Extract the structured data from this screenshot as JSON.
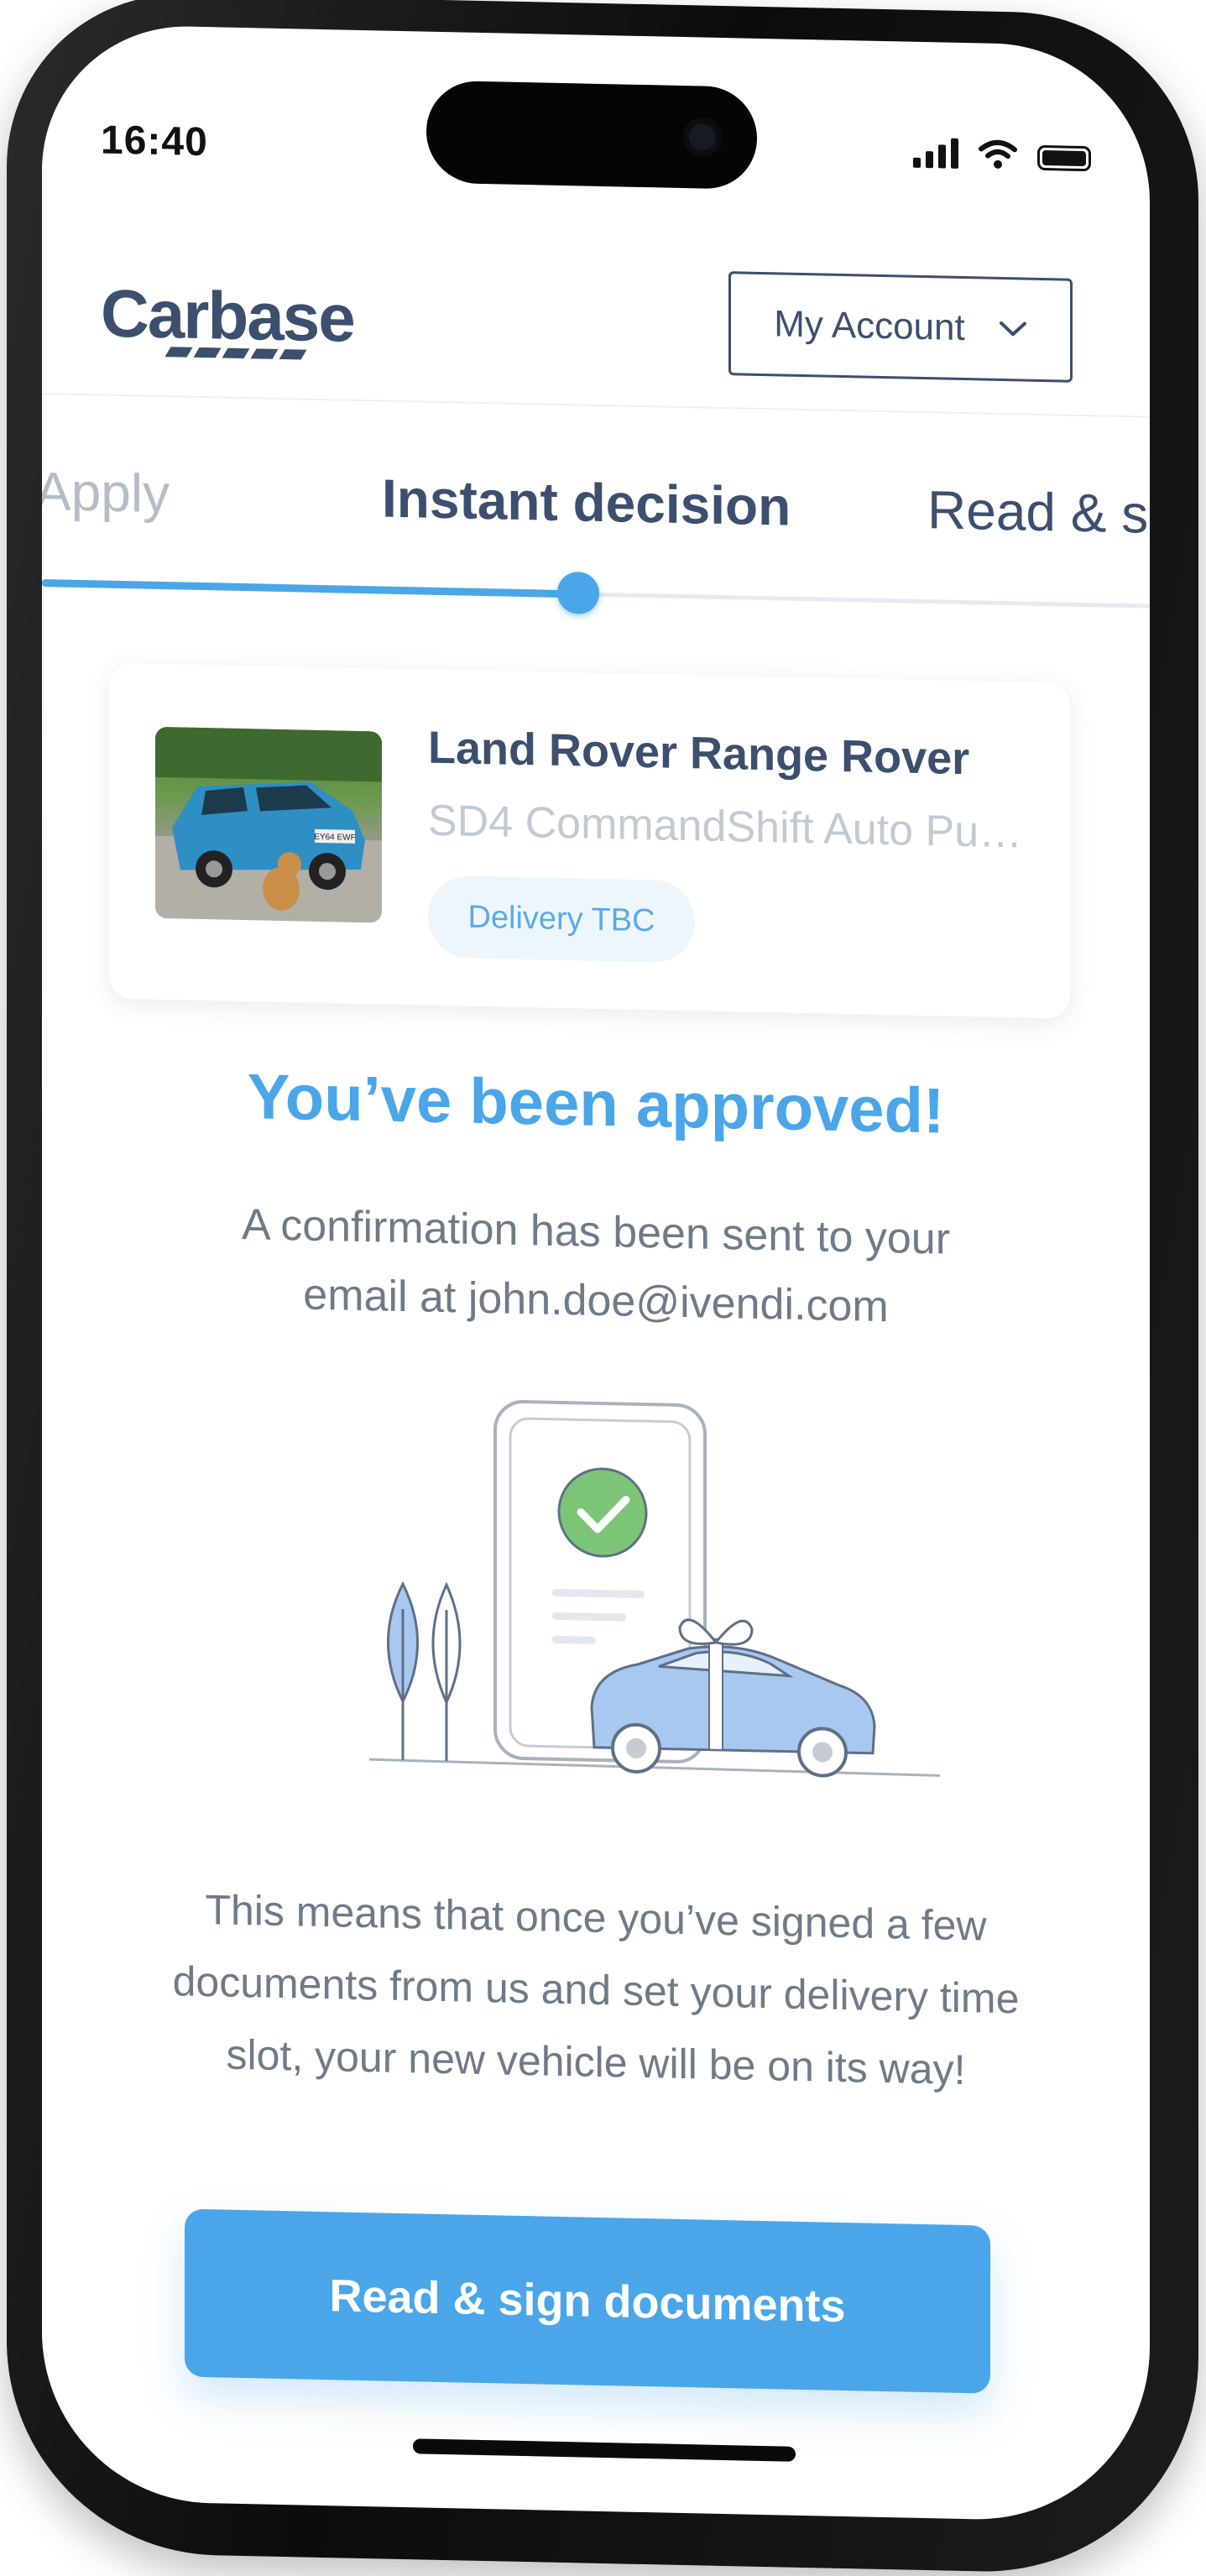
{
  "status_bar": {
    "time": "16:40"
  },
  "brand": {
    "name": "Carbase"
  },
  "header": {
    "account_label": "My Account"
  },
  "steps": [
    "Apply",
    "Instant decision",
    "Read & si"
  ],
  "vehicle": {
    "title": "Land Rover Range Rover",
    "subtitle": "SD4 CommandShift Auto Pu…",
    "badge": "Delivery TBC",
    "plate": "EY64 EWF"
  },
  "approval": {
    "headline": "You’ve been approved!",
    "confirmation": "A confirmation has been sent to your email at john.doe@ivendi.com",
    "explanation": "This means that once you’ve signed a few documents from us and set your delivery time slot, your new vehicle will be on its way!"
  },
  "cta": {
    "label": "Read & sign documents"
  },
  "colors": {
    "accent": "#4aa6e8",
    "brand": "#3d4f6e",
    "muted": "#6f7a89",
    "success": "#7cc576"
  }
}
